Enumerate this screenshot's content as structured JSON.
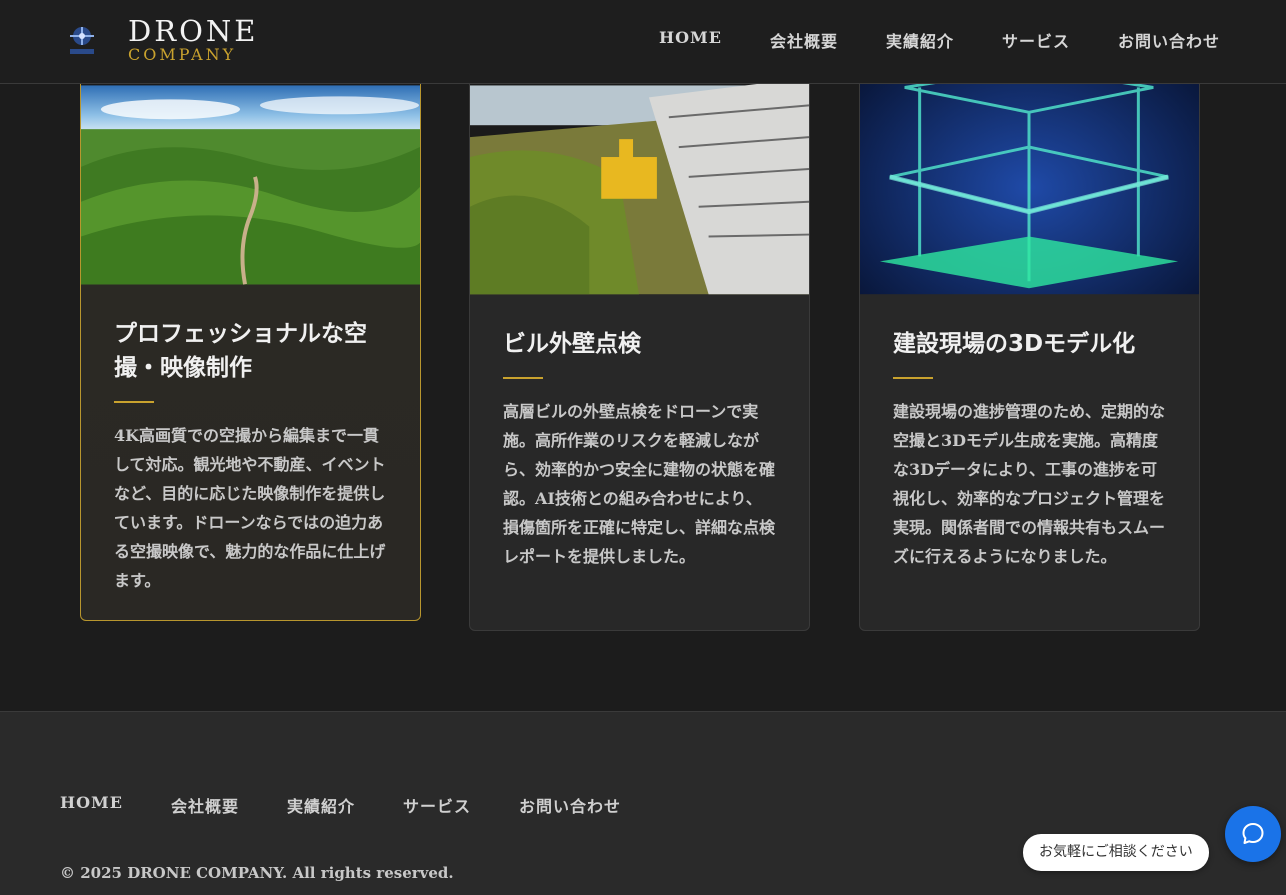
{
  "brand": {
    "title": "DRONE",
    "subtitle": "COMPANY",
    "logo_icon": "drone-logo-icon"
  },
  "nav": [
    "HOME",
    "会社概要",
    "実績紹介",
    "サービス",
    "お問い合わせ"
  ],
  "cards": [
    {
      "title": "プロフェッショナルな空撮・映像制作",
      "text": "4K高画質での空撮から編集まで一貫して対応。観光地や不動産、イベントなど、目的に応じた映像制作を提供しています。ドローンならではの迫力ある空撮映像で、魅力的な作品に仕上げます。",
      "image": "green-hills-aerial-photo"
    },
    {
      "title": "ビル外壁点検",
      "text": "高層ビルの外壁点検をドローンで実施。高所作業のリスクを軽減しながら、効率的かつ安全に建物の状態を確認。AI技術との組み合わせにより、損傷箇所を正確に特定し、詳細な点検レポートを提供しました。",
      "image": "building-facade-drone-photo"
    },
    {
      "title": "建設現場の3Dモデル化",
      "text": "建設現場の進捗管理のため、定期的な空撮と3Dモデル生成を実施。高精度な3Dデータにより、工事の進捗を可視化し、効率的なプロジェクト管理を実現。関係者間での情報共有もスムーズに行えるようになりました。",
      "image": "3d-point-cloud-building"
    }
  ],
  "footer": {
    "nav": [
      "HOME",
      "会社概要",
      "実績紹介",
      "サービス",
      "お問い合わせ"
    ],
    "copyright": "© 2025 DRONE COMPANY. All rights reserved."
  },
  "chat": {
    "label": "お気軽にご相談ください",
    "icon": "chat-bubble-icon"
  },
  "colors": {
    "accent": "#c9a22e",
    "background": "#1c1c1c",
    "card": "#282828",
    "chat": "#1a73e8"
  }
}
